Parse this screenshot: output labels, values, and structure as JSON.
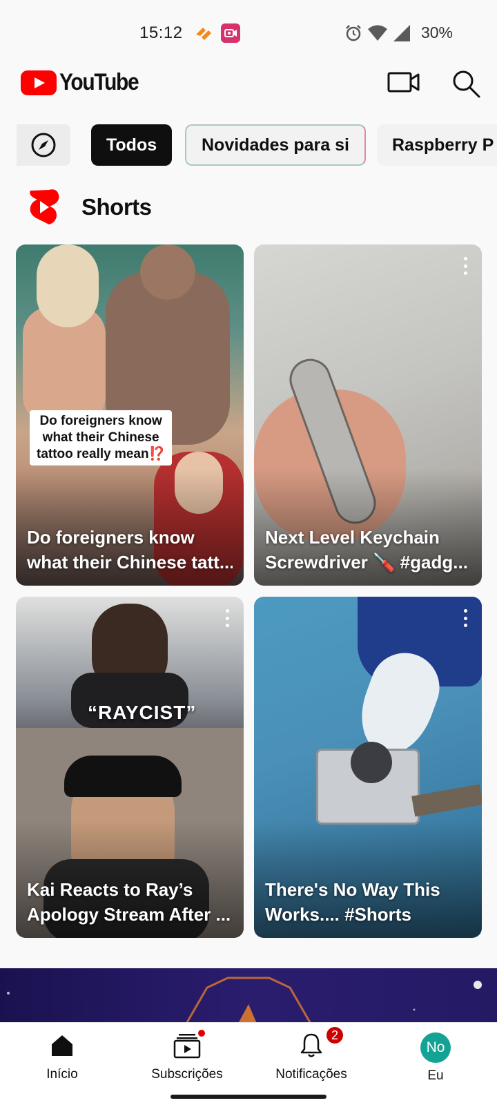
{
  "status_bar": {
    "time": "15:12",
    "battery": "30%",
    "icons": [
      "app-notification-icon",
      "screen-recorder-icon",
      "alarm-icon",
      "wifi-icon",
      "cell-signal-icon"
    ]
  },
  "app_bar": {
    "logo_text": "YouTube",
    "icons": [
      "cast-icon",
      "search-icon"
    ]
  },
  "chips": {
    "explore_icon": "compass-icon",
    "items": [
      {
        "label": "Todos",
        "selected": true
      },
      {
        "label": "Novidades para si",
        "selected": false
      },
      {
        "label": "Raspberry P",
        "selected": false
      }
    ]
  },
  "shorts": {
    "section_title": "Shorts",
    "icon": "shorts-logo-icon",
    "items": [
      {
        "title_line1": "Do foreigners know",
        "title_line2": "what their Chinese tatt...",
        "overlay_caption_line1": "Do foreigners know",
        "overlay_caption_line2": "what their Chinese",
        "overlay_caption_line3": "tattoo really mean⁉️"
      },
      {
        "title_line1": "Next Level Keychain",
        "title_line2": "Screwdriver 🪛 #gadg..."
      },
      {
        "title_line1": "Kai Reacts to Ray’s",
        "title_line2": "Apology Stream After ...",
        "overlay_text": "“RAYCIST”"
      },
      {
        "title_line1": "There's No Way This",
        "title_line2": "Works.... #Shorts"
      }
    ]
  },
  "bottom_nav": {
    "items": [
      {
        "label": "Início",
        "icon": "home-icon"
      },
      {
        "label": "Subscrições",
        "icon": "subscriptions-icon"
      },
      {
        "label": "Notificações",
        "icon": "bell-icon",
        "badge": "2"
      },
      {
        "label": "Eu",
        "avatar_text": "No"
      }
    ]
  },
  "colors": {
    "brand_red": "#ff0000",
    "chip_selected_bg": "#0f0f0f",
    "avatar_bg": "#13a394",
    "badge_red": "#cc0000"
  }
}
